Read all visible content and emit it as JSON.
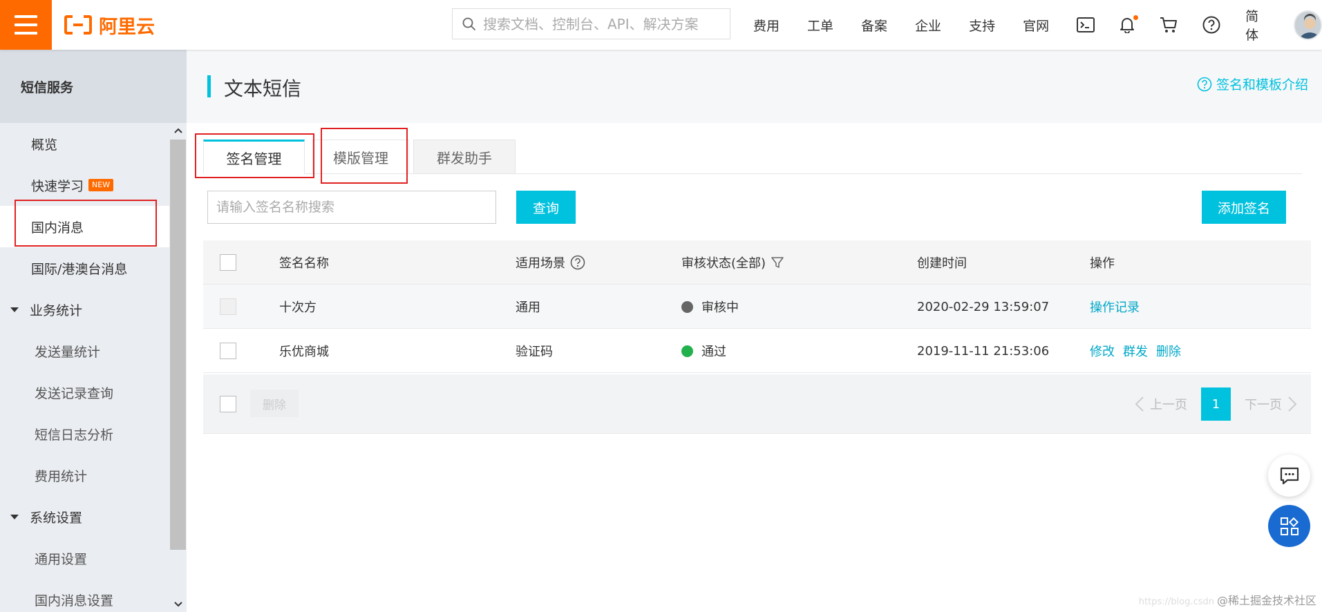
{
  "app": {
    "logo_text": "阿里云",
    "brand_color": "#ff6a00",
    "accent_color": "#00c1de"
  },
  "topbar": {
    "search_placeholder": "搜索文档、控制台、API、解决方案",
    "nav": [
      "费用",
      "工单",
      "备案",
      "企业",
      "支持",
      "官网"
    ],
    "icons": [
      "terminal-icon",
      "bell-icon",
      "cart-icon",
      "help-icon"
    ],
    "lang": "简体"
  },
  "sidebar": {
    "title": "短信服务",
    "items": {
      "overview": "概览",
      "quick_learn": "快速学习",
      "quick_learn_badge": "NEW",
      "domestic": "国内消息",
      "international": "国际/港澳台消息",
      "stats_group": "业务统计",
      "send_stats": "发送量统计",
      "send_records": "发送记录查询",
      "log_analysis": "短信日志分析",
      "cost_stats": "费用统计",
      "settings_group": "系统设置",
      "general_settings": "通用设置",
      "domestic_settings": "国内消息设置"
    }
  },
  "main": {
    "title": "文本短信",
    "help_link": "签名和模板介绍",
    "tabs": {
      "signature": "签名管理",
      "template": "模版管理",
      "group_send": "群发助手"
    },
    "search_placeholder": "请输入签名名称搜索",
    "query_button": "查询",
    "add_button": "添加签名",
    "table": {
      "headers": {
        "name": "签名名称",
        "scene": "适用场景",
        "status": "审核状态(全部)",
        "created": "创建时间",
        "actions": "操作"
      },
      "rows": [
        {
          "name": "十次方",
          "scene": "通用",
          "status": "审核中",
          "status_color": "#666666",
          "created": "2020-02-29 13:59:07",
          "actions": [
            "操作记录"
          ]
        },
        {
          "name": "乐优商城",
          "scene": "验证码",
          "status": "通过",
          "status_color": "#22b14c",
          "created": "2019-11-11 21:53:06",
          "actions": [
            "修改",
            "群发",
            "删除"
          ]
        }
      ]
    },
    "footer": {
      "delete_button": "删除",
      "prev": "上一页",
      "page": "1",
      "next": "下一页"
    }
  },
  "watermark": {
    "faint": "https://blog.csdn",
    "text": "@稀土掘金技术社区"
  }
}
